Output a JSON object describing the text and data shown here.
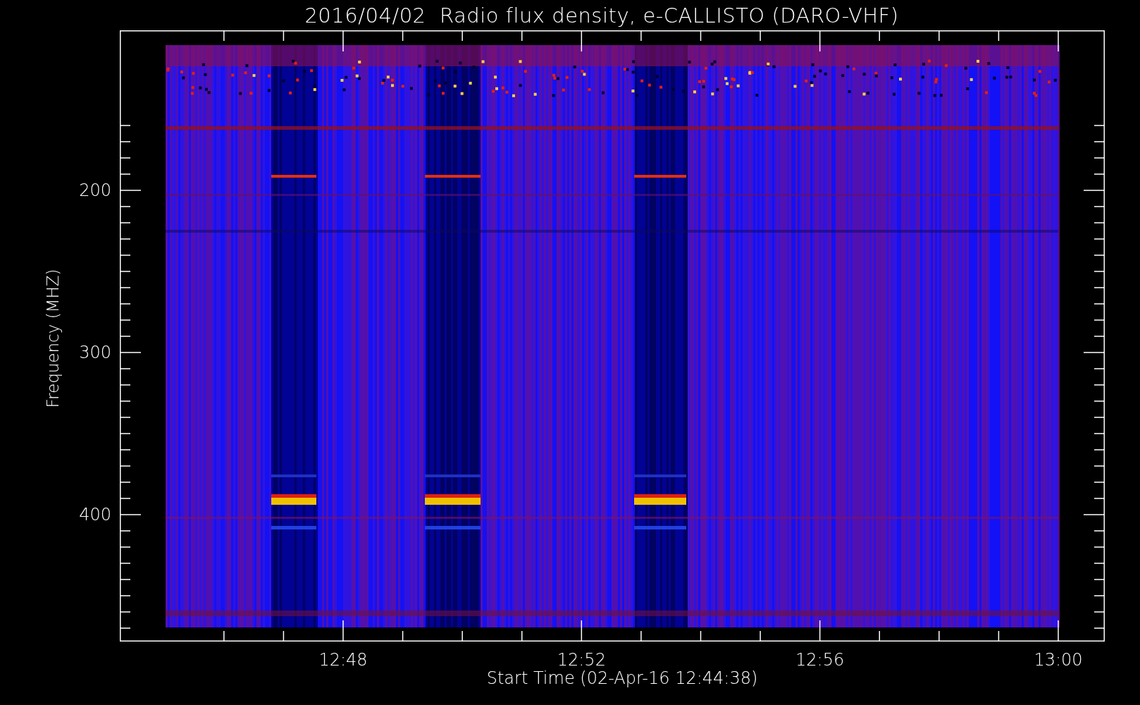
{
  "title": "2016/04/02  Radio flux density, e-CALLISTO (DARO-VHF)",
  "y_axis": {
    "label": "Frequency (MHZ)",
    "ticks": [
      "200",
      "300",
      "400"
    ]
  },
  "x_axis": {
    "label": "Start Time (02-Apr-16 12:44:38)",
    "ticks": [
      "12:48",
      "12:52",
      "12:56",
      "13:00"
    ]
  }
}
